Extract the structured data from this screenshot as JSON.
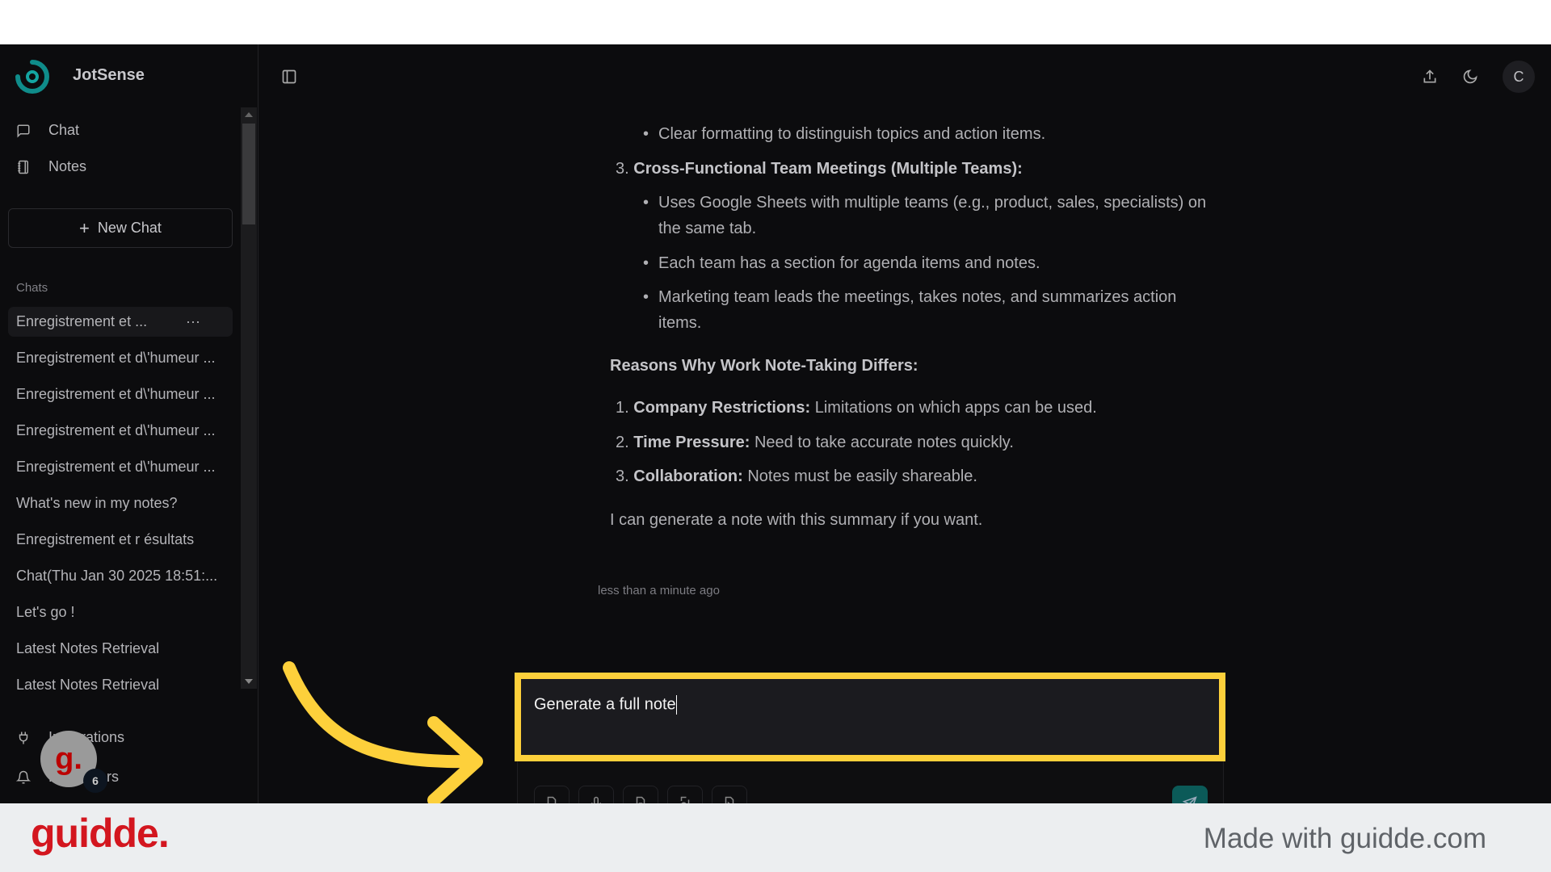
{
  "app": {
    "name": "JotSense",
    "accent": "#0f8c8a",
    "highlight": "#fdd03b"
  },
  "sidebar": {
    "nav": [
      {
        "label": "Chat",
        "icon": "message-square-icon"
      },
      {
        "label": "Notes",
        "icon": "notebook-icon"
      }
    ],
    "new_chat": "New Chat",
    "chats_label": "Chats",
    "chats": [
      "Enregistrement et ...",
      "Enregistrement et d\\'humeur ...",
      "Enregistrement et d\\'humeur ...",
      "Enregistrement et d\\'humeur ...",
      "Enregistrement et d\\'humeur ...",
      "What's new in my notes?",
      "Enregistrement et r ésultats",
      "Chat(Thu Jan 30 2025 18:51:...",
      "Let's go !",
      "Latest Notes Retrieval",
      "Latest Notes Retrieval"
    ],
    "more": "···",
    "bottom": [
      {
        "label": "Integrations",
        "icon": "plug-icon"
      },
      {
        "label": "Reminders",
        "icon": "bell-icon"
      }
    ]
  },
  "overlay": {
    "bubble": "g.",
    "badge": "6"
  },
  "header": {
    "avatar": "C"
  },
  "message": {
    "l1": "Clear formatting to distinguish topics and action items.",
    "l2_num": "3.",
    "l2": "Cross-Functional Team Meetings (Multiple Teams):",
    "l3a": "Uses Google Sheets with multiple teams (e.g., product, sales, specialists) on",
    "l3b": "the same tab.",
    "l4": "Each team has a section for agenda items and notes.",
    "l5a": "Marketing team leads the meetings, takes notes, and summarizes action",
    "l5b": "items.",
    "h": "Reasons Why Work Note-Taking Differs:",
    "r": [
      {
        "n": "1.",
        "k": "Company Restrictions:",
        "v": " Limitations on which apps can be used."
      },
      {
        "n": "2.",
        "k": "Time Pressure:",
        "v": " Need to take accurate notes quickly."
      },
      {
        "n": "3.",
        "k": "Collaboration:",
        "v": " Notes must be easily shareable."
      }
    ],
    "closing": "I can generate a note with this summary if you want.",
    "timestamp": "less than a minute ago"
  },
  "input": {
    "value": "Generate a full note"
  },
  "footer": {
    "logo": "guidde.",
    "made_with": "Made with guidde.com"
  }
}
